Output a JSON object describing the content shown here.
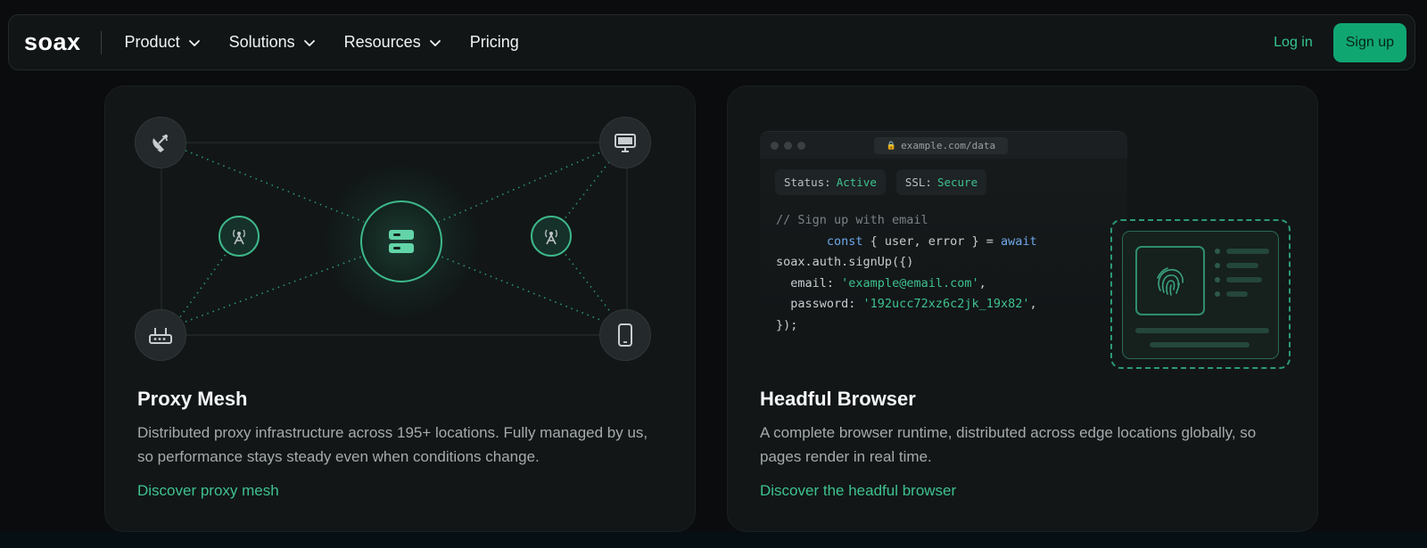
{
  "nav": {
    "logo": "soax",
    "items": [
      {
        "label": "Product",
        "has_dropdown": true
      },
      {
        "label": "Solutions",
        "has_dropdown": true
      },
      {
        "label": "Resources",
        "has_dropdown": true
      },
      {
        "label": "Pricing",
        "has_dropdown": false
      }
    ],
    "login_label": "Log in",
    "signup_label": "Sign up"
  },
  "cards": [
    {
      "title": "Proxy Mesh",
      "description": "Distributed proxy infrastructure across 195+ locations. Fully managed by us, so performance stays steady even when conditions change.",
      "link": "Discover proxy mesh",
      "illustration_icons": [
        "satellite-dish-icon",
        "monitor-icon",
        "router-icon",
        "smartphone-icon",
        "cell-tower-icon",
        "server-hub-icon"
      ]
    },
    {
      "title": "Headful Browser",
      "description": "A complete browser runtime, distributed across edge locations globally, so pages render in real time.",
      "link": "Discover the headful browser",
      "browser": {
        "url": "example.com/data",
        "status_label": "Status:",
        "status_value": "Active",
        "ssl_label": "SSL:",
        "ssl_value": "Secure",
        "code": {
          "comment": "// Sign up with email",
          "kw_const": "const",
          "destructure": " { user, error } = ",
          "kw_await": "await",
          "call": "soax.auth.signUp({)",
          "email_key": "email: ",
          "email_val": "'example@email.com'",
          "password_key": "password: ",
          "password_val": "'192ucc72xz6c2jk_19x82'",
          "close": "});"
        }
      }
    }
  ],
  "colors": {
    "accent": "#10a672",
    "accent_text": "#3ec28f",
    "background": "#0a0c0d",
    "card": "#121617"
  }
}
